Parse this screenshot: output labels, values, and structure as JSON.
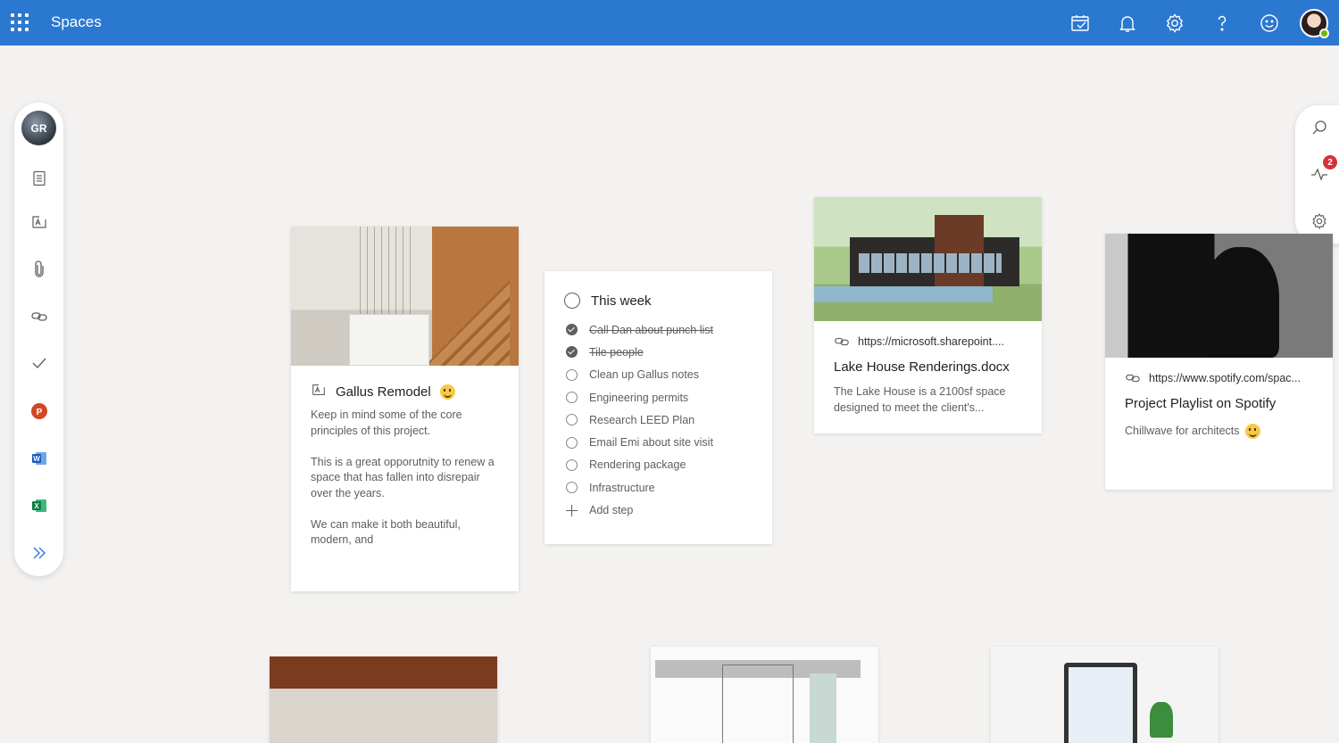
{
  "app": {
    "title": "Spaces"
  },
  "header_icons": [
    "calendar-check-icon",
    "bell-icon",
    "gear-icon",
    "help-icon",
    "feedback-smiley-icon"
  ],
  "left_rail": {
    "avatar_initials": "GR",
    "items": [
      "page-icon",
      "note-icon",
      "attachment-icon",
      "link-icon",
      "checkmark-icon",
      "powerpoint-icon",
      "word-icon",
      "excel-icon",
      "expand-icon"
    ]
  },
  "right_rail": {
    "items": [
      "search-icon",
      "activity-icon",
      "gear-icon"
    ],
    "activity_badge": "2"
  },
  "cards": {
    "gallus": {
      "title": "Gallus Remodel",
      "paragraphs": [
        "Keep in mind some of the core principles of this project.",
        "This is a great opporutnity to renew a space that has fallen into disrepair over the years.",
        "We can make it both beautiful, modern, and"
      ]
    },
    "tasks": {
      "title": "This week",
      "items": [
        {
          "label": "Call Dan about punch list",
          "done": true
        },
        {
          "label": "Tile people",
          "done": true
        },
        {
          "label": "Clean up Gallus notes",
          "done": false
        },
        {
          "label": "Engineering permits",
          "done": false
        },
        {
          "label": "Research LEED Plan",
          "done": false
        },
        {
          "label": "Email Emi about site visit",
          "done": false
        },
        {
          "label": "Rendering package",
          "done": false
        },
        {
          "label": "Infrastructure",
          "done": false
        }
      ],
      "add_label": "Add step"
    },
    "lakehouse": {
      "url": "https://microsoft.sharepoint....",
      "title": "Lake House Renderings.docx",
      "description": "The Lake House is a 2100sf space designed to meet the client's..."
    },
    "spotify": {
      "url": "https://www.spotify.com/spac...",
      "title": "Project Playlist on Spotify",
      "description": "Chillwave for architects"
    }
  },
  "colors": {
    "topbar": "#2b78d0",
    "background": "#f3f2f1",
    "badge": "#d13438"
  }
}
